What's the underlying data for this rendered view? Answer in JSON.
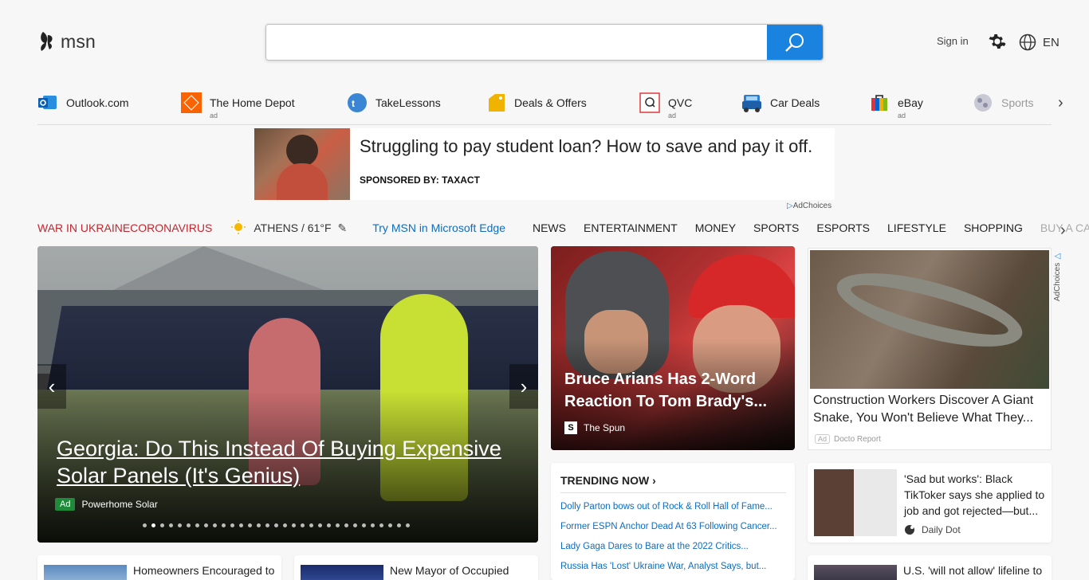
{
  "header": {
    "logo_text": "msn",
    "search_placeholder": "",
    "signin": "Sign in",
    "lang": "EN"
  },
  "quicklinks": [
    {
      "label": "Outlook.com",
      "ad": ""
    },
    {
      "label": "The Home Depot",
      "ad": "ad"
    },
    {
      "label": "TakeLessons",
      "ad": ""
    },
    {
      "label": "Deals & Offers",
      "ad": ""
    },
    {
      "label": "QVC",
      "ad": "ad"
    },
    {
      "label": "Car Deals",
      "ad": ""
    },
    {
      "label": "eBay",
      "ad": "ad"
    },
    {
      "label": "Sports",
      "ad": ""
    }
  ],
  "banner": {
    "headline": "Struggling to pay student loan? How to save and pay it off.",
    "sponsor": "SPONSORED BY: TAXACT",
    "adchoices": "AdChoices"
  },
  "nav": {
    "war": "WAR IN UKRAINE",
    "corona": "CORONAVIRUS",
    "weather": "ATHENS / 61°F",
    "edge": "Try MSN in Microsoft Edge",
    "categories": [
      "NEWS",
      "ENTERTAINMENT",
      "MONEY",
      "SPORTS",
      "ESPORTS",
      "LIFESTYLE",
      "SHOPPING",
      "BUY A CA"
    ]
  },
  "hero": {
    "title": "Georgia: Do This Instead Of Buying Expensive Solar Panels (It's Genius)",
    "ad_label": "Ad",
    "source": "Powerhome Solar",
    "dot_count": 31,
    "active_dot": 1
  },
  "card2": {
    "title": "Bruce Arians Has 2-Word Reaction To Tom Brady's...",
    "source": "The Spun",
    "source_logo": "S"
  },
  "trending": {
    "heading": "TRENDING NOW",
    "items": [
      "Dolly Parton bows out of Rock & Roll Hall of Fame...",
      "Former ESPN Anchor Dead At 63 Following Cancer...",
      "Lady Gaga Dares to Bare at the 2022 Critics...",
      "Russia Has 'Lost' Ukraine War, Analyst Says, but..."
    ]
  },
  "ad3": {
    "title": "Construction Workers Discover A Giant Snake, You Won't Believe What They...",
    "ad_label": "Ad",
    "source": "Docto Report",
    "adchoices": "AdChoices"
  },
  "card4": {
    "title": "'Sad but works': Black TikToker says she applied to job and got rejected—but...",
    "source": "Daily Dot"
  },
  "bottom": [
    {
      "title": "Homeowners Encouraged to"
    },
    {
      "title": "New Mayor of Occupied"
    },
    {
      "title": "U.S. 'will not allow' lifeline to"
    }
  ],
  "colors": {
    "accent": "#1a83e0",
    "nav_red": "#c4262e",
    "link_blue": "#0f6cbd",
    "ad_green": "#1f8a3a"
  }
}
